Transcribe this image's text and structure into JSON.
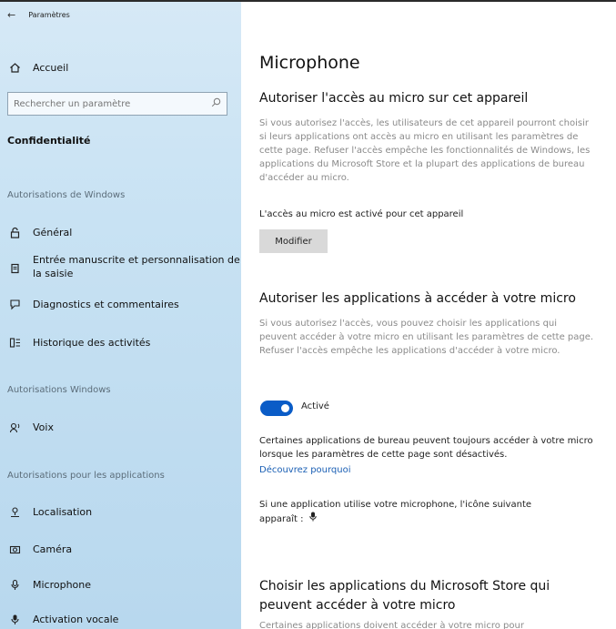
{
  "window": {
    "title": "Paramètres"
  },
  "sidebar": {
    "home_label": "Accueil",
    "search_placeholder": "Rechercher un paramètre",
    "category": "Confidentialité",
    "section_windows_permissions": "Autorisations de Windows",
    "items_windows": [
      {
        "label": "Général",
        "icon": "lock-icon"
      },
      {
        "label": "Entrée manuscrite et personnalisation de",
        "label2": "la saisie",
        "icon": "clipboard-icon"
      },
      {
        "label": "Diagnostics et commentaires",
        "icon": "feedback-icon"
      },
      {
        "label": "Historique des activités",
        "icon": "timeline-icon"
      }
    ],
    "section_windows": "Autorisations Windows",
    "items_voice": [
      {
        "label": "Voix",
        "icon": "voice-icon"
      }
    ],
    "section_apps": "Autorisations pour les applications",
    "items_apps": [
      {
        "label": "Localisation",
        "icon": "location-icon"
      },
      {
        "label": "Caméra",
        "icon": "camera-icon"
      },
      {
        "label": "Microphone",
        "icon": "microphone-icon"
      },
      {
        "label": "Activation vocale",
        "icon": "voice-activation-icon"
      }
    ]
  },
  "main": {
    "title": "Microphone",
    "device_access": {
      "heading": "Autoriser l'accès au micro sur cet appareil",
      "description": "Si vous autorisez l'accès, les utilisateurs de cet appareil pourront choisir si leurs applications ont accès au micro en utilisant les paramètres de cette page. Refuser l'accès empêche les fonctionnalités de Windows, les applications du Microsoft Store et la plupart des applications de bureau d'accéder au micro.",
      "status": "L'accès au micro est activé pour cet appareil",
      "button": "Modifier"
    },
    "app_access": {
      "heading": "Autoriser les applications à accéder à votre micro",
      "description": "Si vous autorisez l'accès, vous pouvez choisir les applications qui peuvent accéder à votre micro en utilisant les paramètres de cette page. Refuser l'accès empêche les applications d'accéder à votre micro.",
      "toggle_label": "Activé",
      "toggle_on": true,
      "note": "Certaines applications de bureau peuvent toujours accéder à votre micro lorsque les paramètres de cette page sont désactivés.",
      "link": "Découvrez pourquoi",
      "icon_note": "Si une application utilise votre microphone, l'icône suivante apparaît :"
    },
    "store_apps": {
      "heading_line1": "Choisir les applications du Microsoft Store qui",
      "heading_line2": "peuvent accéder à votre micro",
      "description_partial": "Certaines applications doivent accéder à votre micro pour"
    }
  },
  "colors": {
    "accent": "#0a5cc7",
    "sidebar_bg": "#c8e2f3",
    "link": "#1a5fb4"
  }
}
